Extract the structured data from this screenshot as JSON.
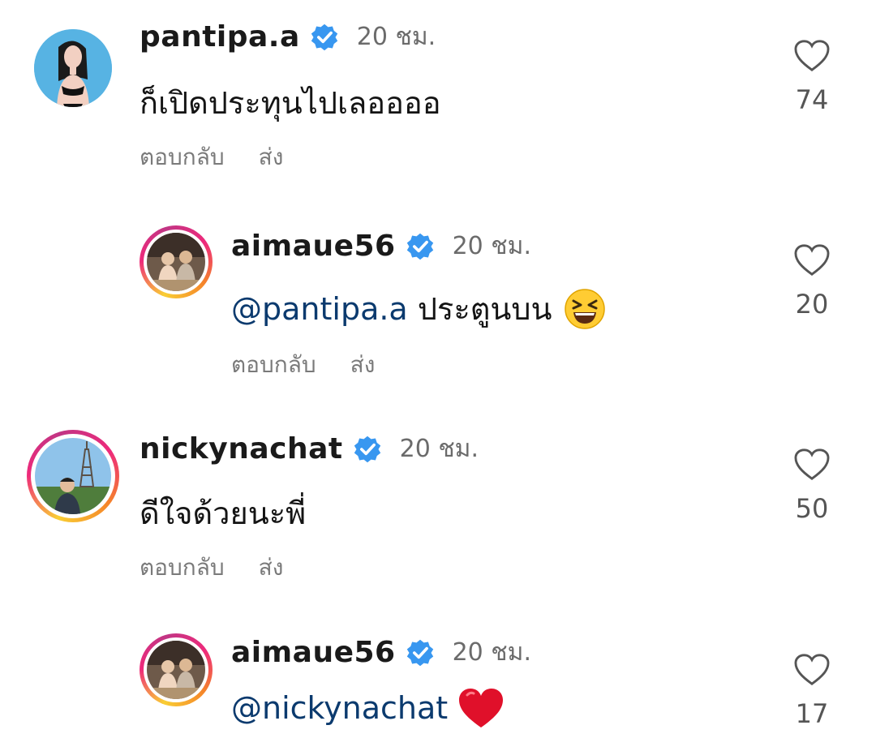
{
  "comments": [
    {
      "username": "pantipa.a",
      "time": "20 ชม.",
      "text": "ก็เปิดประทุนไปเลออออ",
      "reply_label": "ตอบกลับ",
      "send_label": "ส่ง",
      "likes": "74"
    },
    {
      "username": "aimaue56",
      "time": "20 ชม.",
      "mention": "@pantipa.a",
      "text": " ประตูนบน",
      "emoji": "grinning-squinting-face",
      "reply_label": "ตอบกลับ",
      "send_label": "ส่ง",
      "likes": "20"
    },
    {
      "username": "nickynachat",
      "time": "20 ชม.",
      "text": "ดีใจด้วยนะพี่",
      "reply_label": "ตอบกลับ",
      "send_label": "ส่ง",
      "likes": "50"
    },
    {
      "username": "aimaue56",
      "time": "20 ชม.",
      "mention": "@nickynachat",
      "emoji": "red-heart",
      "likes": "17"
    }
  ],
  "colors": {
    "verified": "#3897f0",
    "mention": "#0b3a6e",
    "secondary_text": "#7a7a7a"
  }
}
